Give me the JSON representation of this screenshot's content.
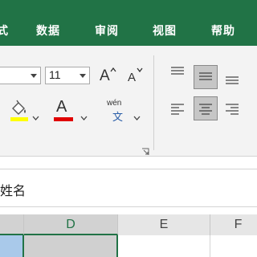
{
  "menu": {
    "tabs": [
      {
        "label": "式"
      },
      {
        "label": "数据"
      },
      {
        "label": "审阅"
      },
      {
        "label": "视图"
      },
      {
        "label": "帮助"
      }
    ]
  },
  "font_group": {
    "font_size": "11",
    "grow_label": "A",
    "shrink_label": "A",
    "font_color_label": "A",
    "phonetic_top": "wén",
    "phonetic_bottom": "文",
    "fill_color": "#ffff00",
    "font_color": "#e00000"
  },
  "formula_bar": {
    "content": "姓名"
  },
  "grid": {
    "columns": [
      {
        "label": ""
      },
      {
        "label": "D"
      },
      {
        "label": "E"
      },
      {
        "label": "F"
      }
    ]
  },
  "colors": {
    "accent": "#217346"
  }
}
